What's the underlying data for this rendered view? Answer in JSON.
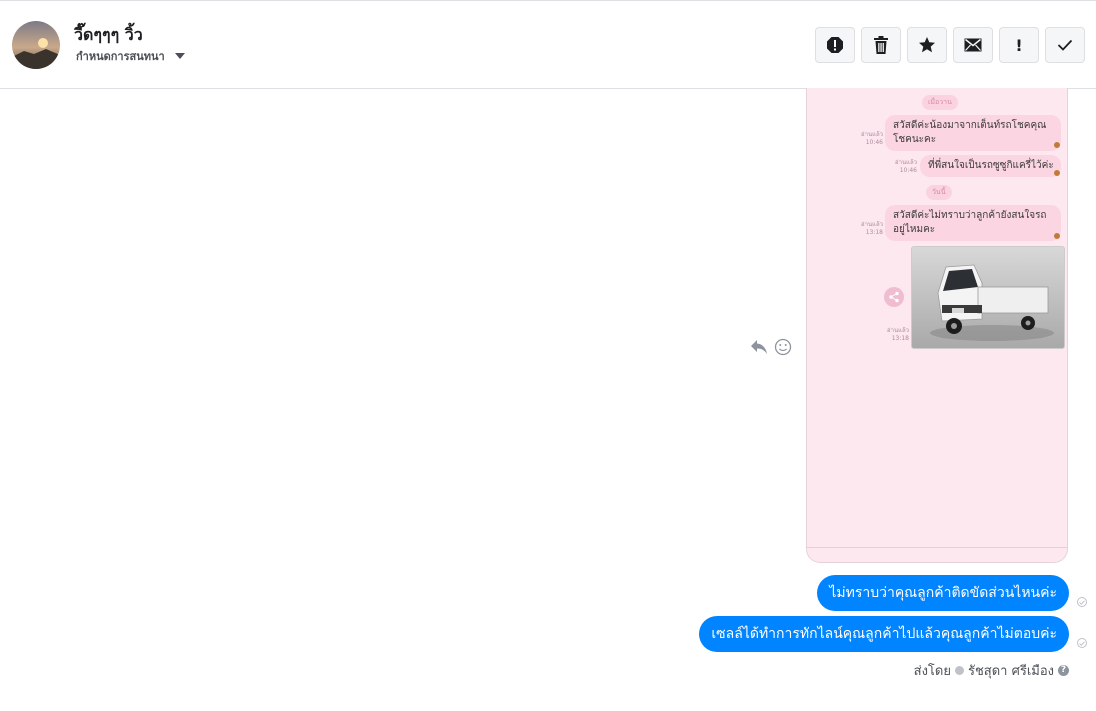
{
  "header": {
    "contact_name": "วี๊ดๆๆๆ วิ้ว",
    "label_menu": "กำหนดการสนทนา",
    "toolbar": {
      "buttons": [
        "spam-icon",
        "trash-icon",
        "star-icon",
        "mail-icon",
        "important-icon",
        "check-icon"
      ],
      "important_glyph": "!"
    }
  },
  "screenshot": {
    "day1_pill": "เมื่อวาน",
    "read_label": "อ่านแล้ว",
    "msg1": "สวัสดีค่ะน้องมาจากเต็นท์รถโชคคุณโชคนะคะ",
    "msg1_time": "10:46",
    "msg2": "ที่พี่สนใจเป็นรถซูซูกิแครี่ไว้ค่ะ",
    "msg2_time": "10:46",
    "day2_pill": "วันนี้",
    "msg3": "สวัสดีค่ะไม่ทราบว่าลูกค้ายังสนใจรถอยู่ไหมคะ",
    "msg3_time": "13:18",
    "photo_time": "13:18"
  },
  "messages": [
    {
      "text": "ไม่ทราบว่าคุณลูกค้าติดขัดส่วนไหนค่ะ"
    },
    {
      "text": "เซลล์ได้ทำการทักไลน์คุณลูกค้าไปแล้วคุณลูกค้าไม่ตอบค่ะ"
    }
  ],
  "sent_by": {
    "label": "ส่งโดย",
    "name": "รัชสุดา ศรีเมือง"
  },
  "colors": {
    "accent": "#0084ff",
    "chat_bg": "#fde8ef",
    "bubble_pink": "#fbd5e2"
  }
}
